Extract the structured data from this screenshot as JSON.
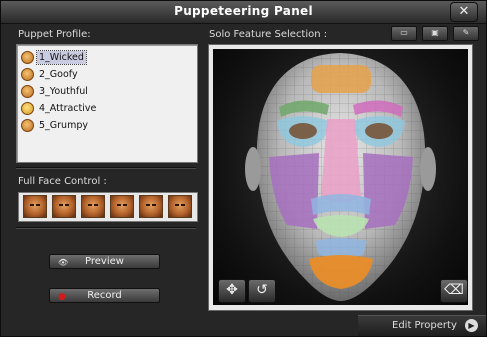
{
  "window": {
    "title": "Puppeteering Panel",
    "close_label": "✕"
  },
  "profile": {
    "label": "Puppet Profile:",
    "items": [
      {
        "label": "1_Wicked",
        "selected": true
      },
      {
        "label": "2_Goofy",
        "selected": false
      },
      {
        "label": "3_Youthful",
        "selected": false
      },
      {
        "label": "4_Attractive",
        "selected": false
      },
      {
        "label": "5_Grumpy",
        "selected": false
      }
    ]
  },
  "full_face": {
    "label": "Full Face Control :",
    "button_count": 6
  },
  "controls": {
    "preview_label": "Preview",
    "record_label": "Record"
  },
  "solo": {
    "label": "Solo Feature Selection :"
  },
  "toolbar": {
    "icons": [
      "folder-open-icon",
      "save-icon",
      "wrench-icon"
    ]
  },
  "footer": {
    "edit_property_label": "Edit Property"
  },
  "colors": {
    "record": "#d11a1a",
    "selection": "#c9cce0"
  }
}
